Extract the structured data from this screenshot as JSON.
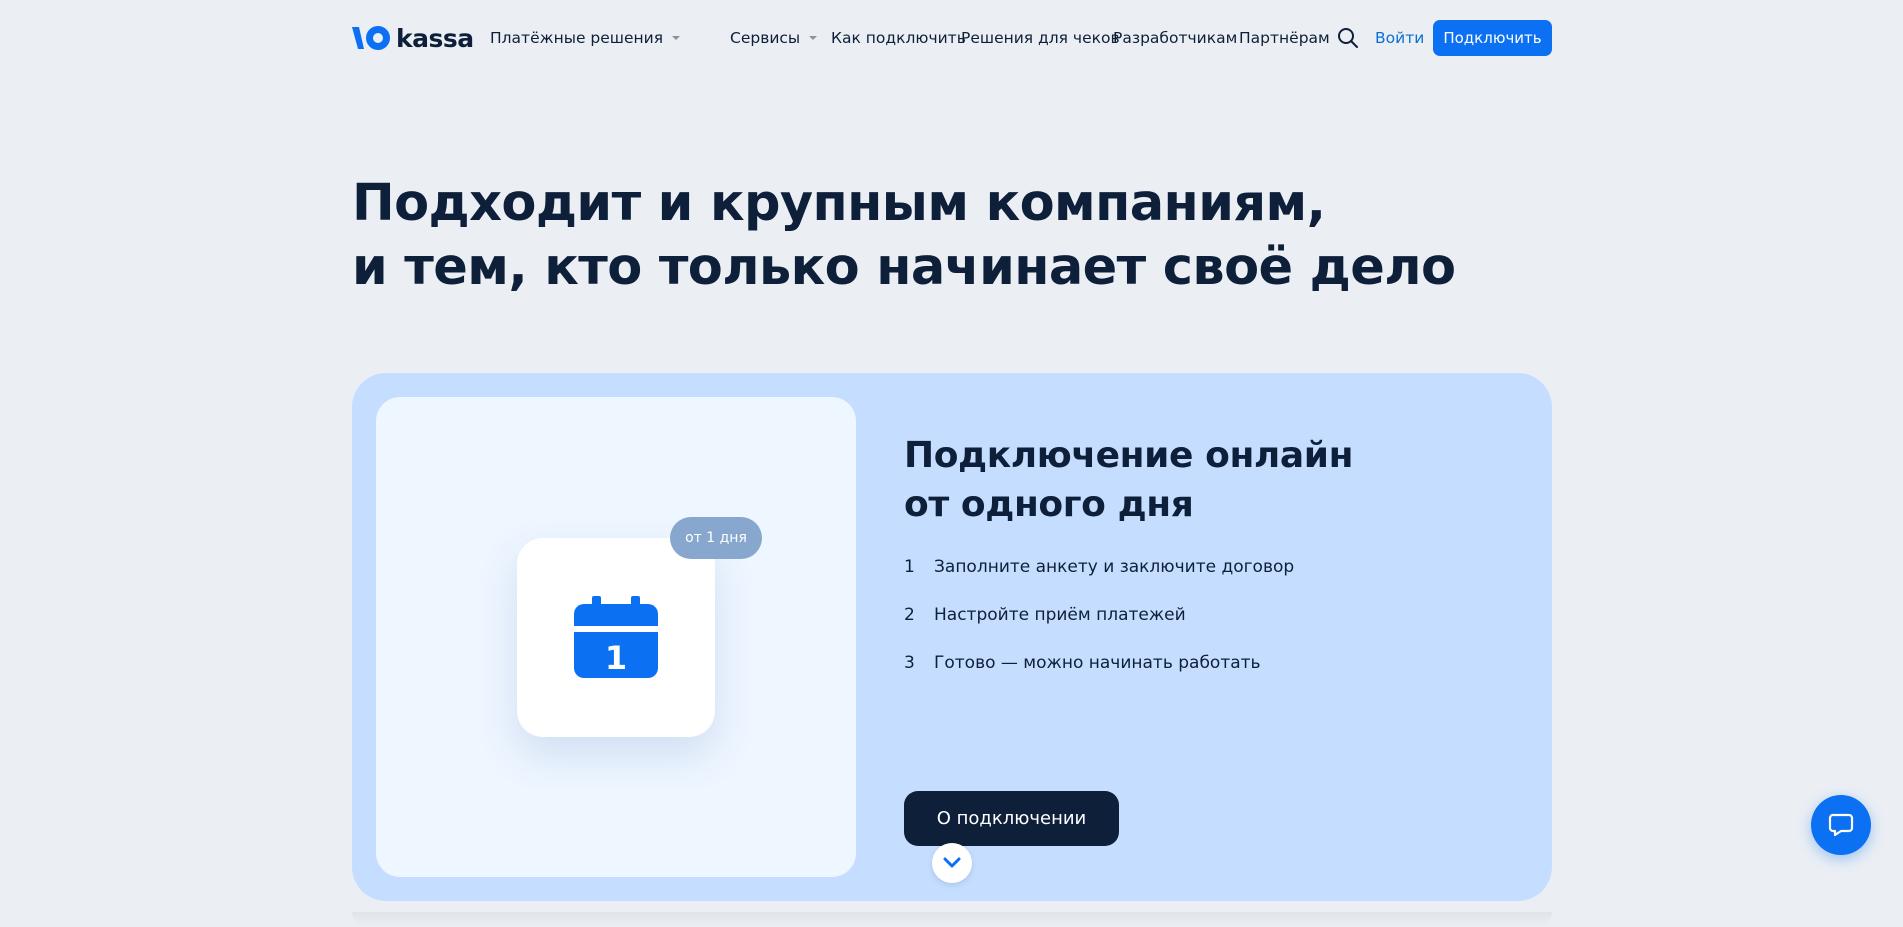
{
  "header": {
    "logo_text": "kassa",
    "nav": {
      "payment_solutions": "Платёжные решения",
      "services": "Сервисы",
      "how_to_connect": "Как подключить",
      "receipts": "Решения для чеков",
      "developers": "Разработчикам",
      "partners": "Партнёрам"
    },
    "login": "Войти",
    "connect": "Подключить"
  },
  "hero": {
    "line1": "Подходит и крупным компаниям,",
    "line2": "и тем, кто только начинает своё дело"
  },
  "card": {
    "badge": "от 1 дня",
    "calendar_day": "1",
    "title_line1": "Подключение онлайн",
    "title_line2": "от одного дня",
    "steps": [
      {
        "num": "1",
        "text": "Заполните анкету и заключите договор"
      },
      {
        "num": "2",
        "text": "Настройте приём платежей"
      },
      {
        "num": "3",
        "text": "Готово — можно начинать работать"
      }
    ],
    "cta": "О подключении"
  },
  "colors": {
    "brand": "#0c70f2",
    "dark": "#0e1f3a",
    "card_bg": "#c5deff",
    "page_bg": "#ebeff4"
  },
  "icons": {
    "logo": "yoomoney-logo-icon",
    "search": "search-icon",
    "calendar": "calendar-icon",
    "scroll": "chevron-down-icon",
    "chat": "chat-icon"
  }
}
